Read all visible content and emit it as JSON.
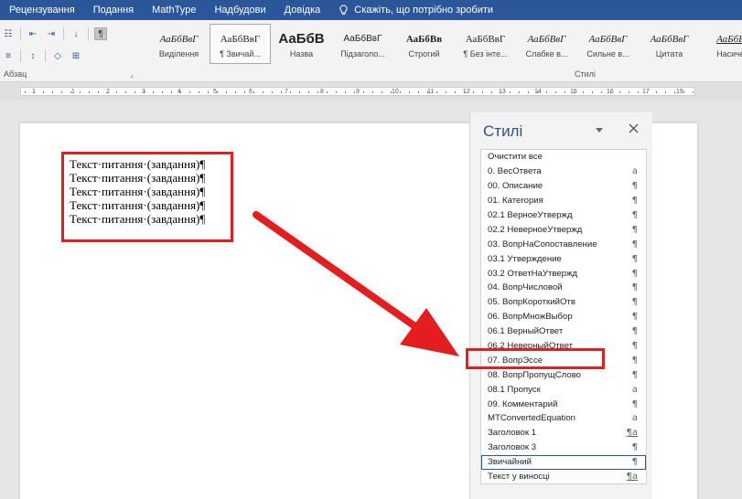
{
  "menu": {
    "items": [
      "Рецензування",
      "Подання",
      "MathType",
      "Надбудови",
      "Довідка"
    ],
    "tell_me": "Скажіть, що потрібно зробити",
    "tell_me_icon": "lightbulb-icon"
  },
  "ribbon": {
    "paragraph_group_label": "Абзац",
    "styles_group_label": "Стилі",
    "gallery": [
      {
        "preview": "АаБбВвГ",
        "name": "Виділення"
      },
      {
        "preview": "АаБбВвГ",
        "name": "¶ Звичай...",
        "selected": true
      },
      {
        "preview": "АаБбВ",
        "name": "Назва"
      },
      {
        "preview": "АаБбВвГ",
        "name": "Підзаголо..."
      },
      {
        "preview": "АаБбВв",
        "name": "Строгий"
      },
      {
        "preview": "АаБбВвГ",
        "name": "¶ Без інте..."
      },
      {
        "preview": "АаБбВвГ",
        "name": "Слабке в..."
      },
      {
        "preview": "АаБбВвГ",
        "name": "Сильне в..."
      },
      {
        "preview": "АаБбВвГ",
        "name": "Цитата"
      },
      {
        "preview": "АаБбВ",
        "name": "Насиче"
      }
    ]
  },
  "ruler": {
    "ticks": [
      "1",
      "1",
      "2",
      "3",
      "4",
      "5",
      "6",
      "7",
      "8",
      "9",
      "10",
      "11",
      "12",
      "13",
      "14",
      "15",
      "16",
      "17",
      "19"
    ]
  },
  "document": {
    "lines": [
      "Текст·питання·(завдання)¶",
      "Текст·питання·(завдання)¶",
      "Текст·питання·(завдання)¶",
      "Текст·питання·(завдання)¶",
      "Текст·питання·(завдання)¶"
    ]
  },
  "styles_pane": {
    "title": "Стилі",
    "dropdown_icon": "chevron-down-icon",
    "close_icon": "close-icon",
    "items": [
      {
        "name": "Очистити все",
        "mark": ""
      },
      {
        "name": "0. ВесОтвета",
        "mark": "a"
      },
      {
        "name": "00. Описание",
        "mark": "¶"
      },
      {
        "name": "01. Категория",
        "mark": "¶"
      },
      {
        "name": "02.1 ВерноеУтвержд",
        "mark": "¶"
      },
      {
        "name": "02.2 НеверноеУтвержд",
        "mark": "¶"
      },
      {
        "name": "03. ВопрНаСопоставление",
        "mark": "¶"
      },
      {
        "name": "03.1 Утверждение",
        "mark": "¶"
      },
      {
        "name": "03.2 ОтветНаУтвержд",
        "mark": "¶"
      },
      {
        "name": "04. ВопрЧисловой",
        "mark": "¶"
      },
      {
        "name": "05. ВопрКороткийОтв",
        "mark": "¶"
      },
      {
        "name": "06. ВопрМножВыбор",
        "mark": "¶"
      },
      {
        "name": "06.1 ВерныйОтвет",
        "mark": "¶"
      },
      {
        "name": "06.2 НеверныйОтвет",
        "mark": "¶"
      },
      {
        "name": "07. ВопрЭссе",
        "mark": "¶"
      },
      {
        "name": "08. ВопрПропущСлово",
        "mark": "¶"
      },
      {
        "name": "08.1 Пропуск",
        "mark": "a"
      },
      {
        "name": "09. Комментарий",
        "mark": "¶"
      },
      {
        "name": "MTConvertedEquation",
        "mark": "a"
      },
      {
        "name": "Заголовок 1",
        "mark": "¶a"
      },
      {
        "name": "Заголовок 3",
        "mark": "¶"
      },
      {
        "name": "Звичайний",
        "mark": "¶",
        "current": true
      },
      {
        "name": "Текст у виносці",
        "mark": "¶a"
      }
    ]
  },
  "colors": {
    "ribbon_blue": "#2b579a",
    "annotation_red": "#e41e1e",
    "pane_title": "#2e4e8f"
  }
}
